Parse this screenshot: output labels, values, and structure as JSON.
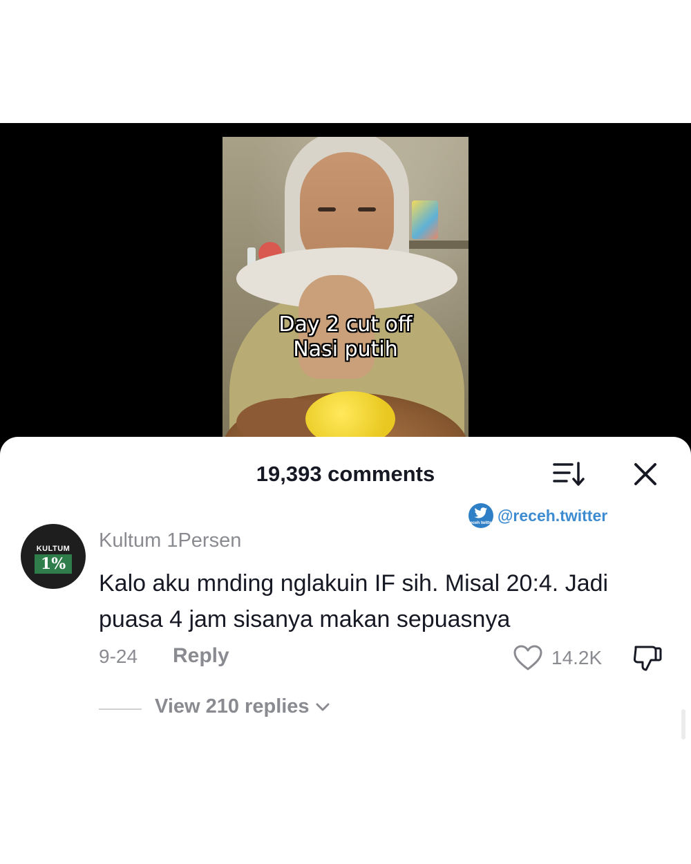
{
  "video": {
    "caption_line1": "Day 2 cut off",
    "caption_line2": "Nasi putih"
  },
  "header": {
    "comments_count": "19,393 comments",
    "sort_icon": "sort-descending-icon",
    "close_icon": "close-icon"
  },
  "watermark": {
    "logo_text": "receh twitter",
    "handle": "@receh.twitter"
  },
  "comment": {
    "avatar_label_top": "KULTUM",
    "avatar_label_badge": "1%",
    "username": "Kultum 1Persen",
    "text": "Kalo aku mnding nglakuin IF sih. Misal 20:4. Jadi puasa 4 jam sisanya makan sepuasnya",
    "date": "9-24",
    "reply_label": "Reply",
    "like_count": "14.2K",
    "view_replies": "View 210 replies"
  },
  "colors": {
    "text_primary": "#161823",
    "text_secondary": "#8a8b91",
    "watermark_blue": "#3d8bd0",
    "avatar_green": "#2e7d4a"
  }
}
